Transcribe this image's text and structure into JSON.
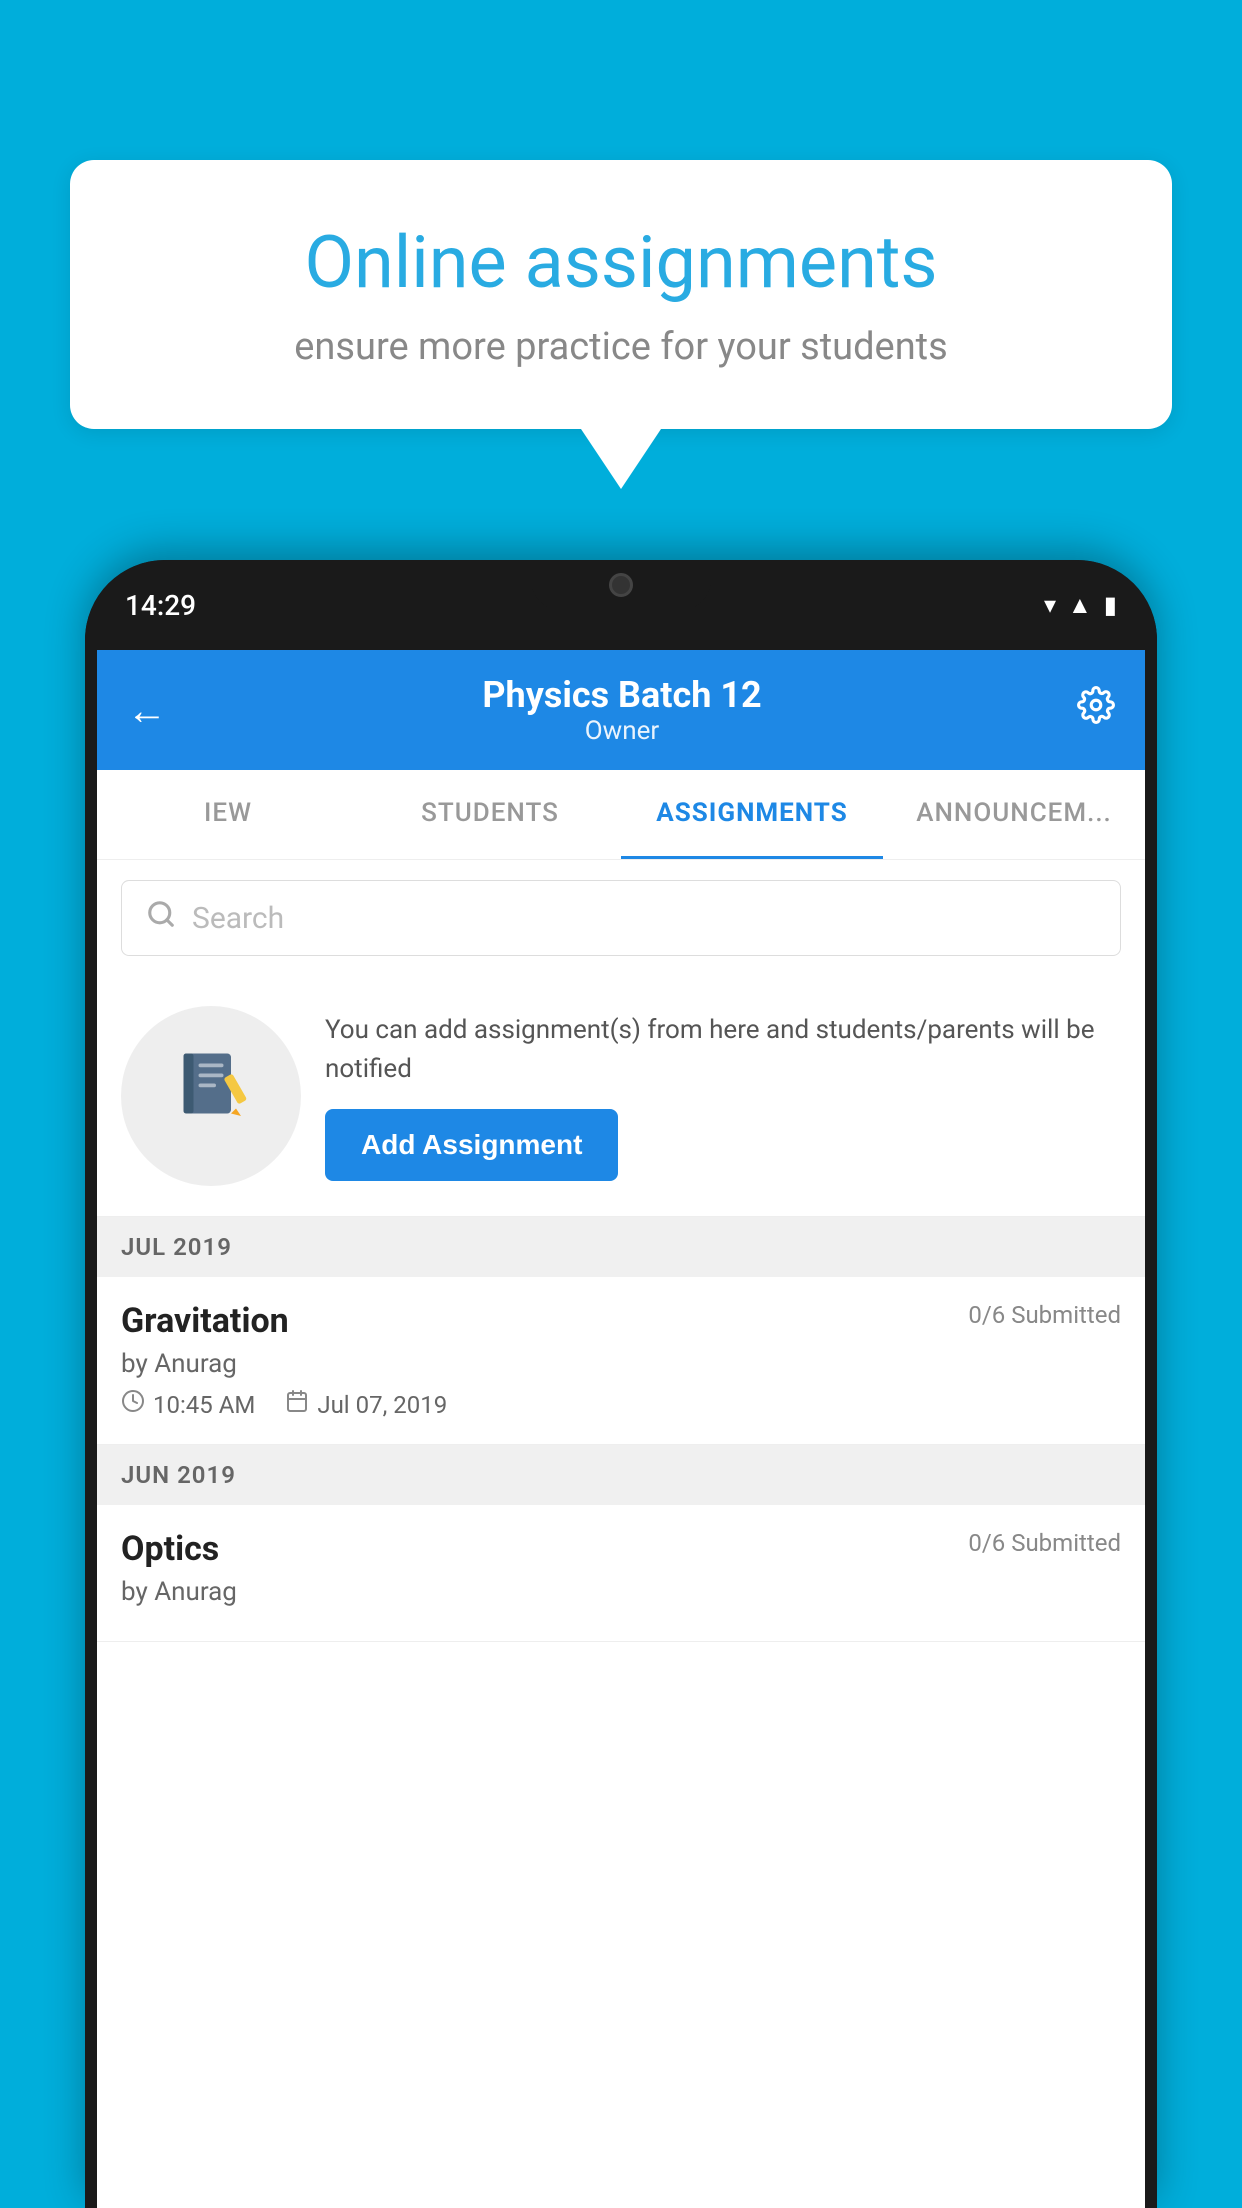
{
  "background": {
    "color": "#00AEDB"
  },
  "speech_bubble": {
    "title": "Online assignments",
    "subtitle": "ensure more practice for your students"
  },
  "phone": {
    "status_bar": {
      "time": "14:29"
    },
    "header": {
      "title": "Physics Batch 12",
      "subtitle": "Owner",
      "back_label": "←",
      "settings_label": "⚙"
    },
    "tabs": [
      {
        "label": "IEW",
        "active": false
      },
      {
        "label": "STUDENTS",
        "active": false
      },
      {
        "label": "ASSIGNMENTS",
        "active": true
      },
      {
        "label": "ANNOUNCEMENTS",
        "active": false
      }
    ],
    "search": {
      "placeholder": "Search"
    },
    "promo": {
      "text": "You can add assignment(s) from here and students/parents will be notified",
      "button_label": "Add Assignment"
    },
    "sections": [
      {
        "label": "JUL 2019",
        "assignments": [
          {
            "name": "Gravitation",
            "submitted": "0/6 Submitted",
            "author": "by Anurag",
            "time": "10:45 AM",
            "date": "Jul 07, 2019"
          }
        ]
      },
      {
        "label": "JUN 2019",
        "assignments": [
          {
            "name": "Optics",
            "submitted": "0/6 Submitted",
            "author": "by Anurag",
            "time": "",
            "date": ""
          }
        ]
      }
    ]
  }
}
